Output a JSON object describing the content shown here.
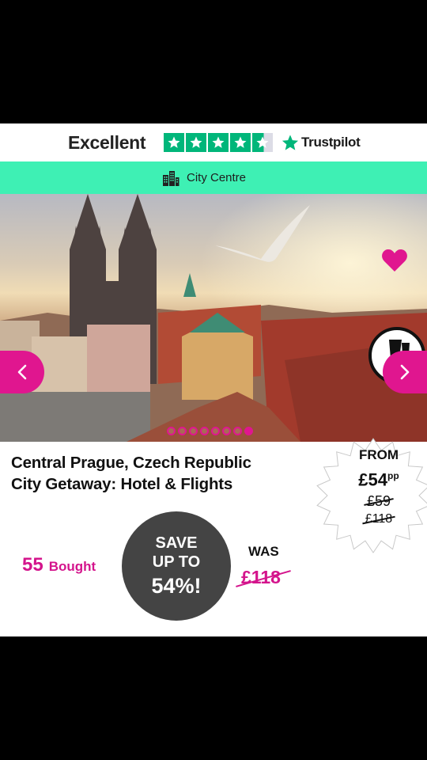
{
  "trustpilot": {
    "rating_label": "Excellent",
    "brand": "Trustpilot",
    "brand_color": "#00b67a",
    "stars": 4.5
  },
  "location": {
    "icon": "city-buildings-icon",
    "label": "City Centre",
    "bar_color": "#3ef0b4"
  },
  "carousel": {
    "slide_count": 8,
    "active_index": 7,
    "accent_color": "#e0168f"
  },
  "deal": {
    "title_line1": "Central Prague, Czech Republic",
    "title_line2": "City Getaway: Hotel & Flights"
  },
  "price": {
    "from_label": "FROM",
    "amount": "£54",
    "per_person": "pp",
    "old_price_1": "£59",
    "old_price_2": "£118"
  },
  "stats": {
    "bought_count": "55",
    "bought_label": "Bought",
    "save_line1": "SAVE",
    "save_line2": "UP TO",
    "save_percent": "54%!",
    "was_label": "WAS",
    "was_price": "£118"
  }
}
